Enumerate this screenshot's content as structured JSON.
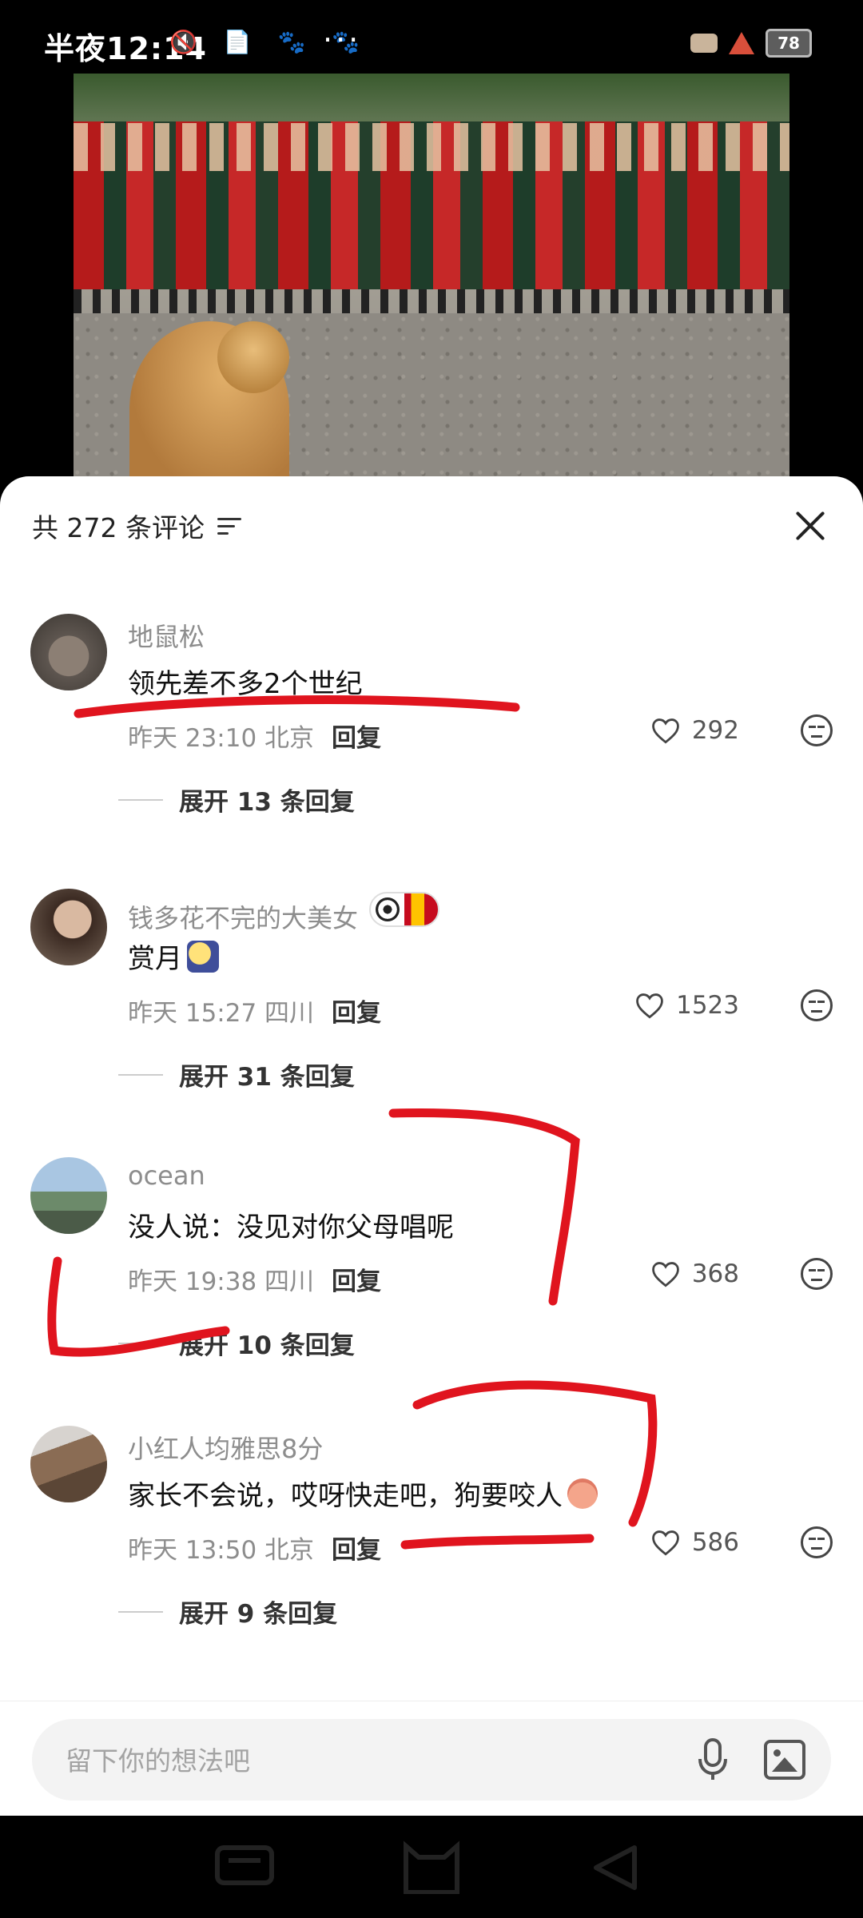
{
  "status_bar": {
    "time": "半夜12:14",
    "left_icons": "🔇 📄 🐾 🐾",
    "dots": "···",
    "battery": "78"
  },
  "sheet": {
    "title": "共 272 条评论"
  },
  "comments": [
    {
      "username": "地鼠松",
      "text": "领先差不多2个世纪",
      "time": "昨天 23:10 北京",
      "reply_label": "回复",
      "likes": "292",
      "expand": "展开 13 条回复"
    },
    {
      "username": "钱多花不完的大美女",
      "text": "赏月",
      "time": "昨天 15:27 四川",
      "reply_label": "回复",
      "likes": "1523",
      "expand": "展开 31 条回复"
    },
    {
      "username": "ocean",
      "text": "没人说：没见对你父母唱呢",
      "time": "昨天 19:38 四川",
      "reply_label": "回复",
      "likes": "368",
      "expand": "展开 10 条回复"
    },
    {
      "username": "小红人均雅思8分",
      "text": "家长不会说，哎呀快走吧，狗要咬人",
      "time": "昨天 13:50 北京",
      "reply_label": "回复",
      "likes": "586",
      "expand": "展开 9 条回复"
    }
  ],
  "input": {
    "placeholder": "留下你的想法吧"
  },
  "colors": {
    "annotation_red": "#e0141e",
    "muted_text": "#8d8d8d"
  }
}
